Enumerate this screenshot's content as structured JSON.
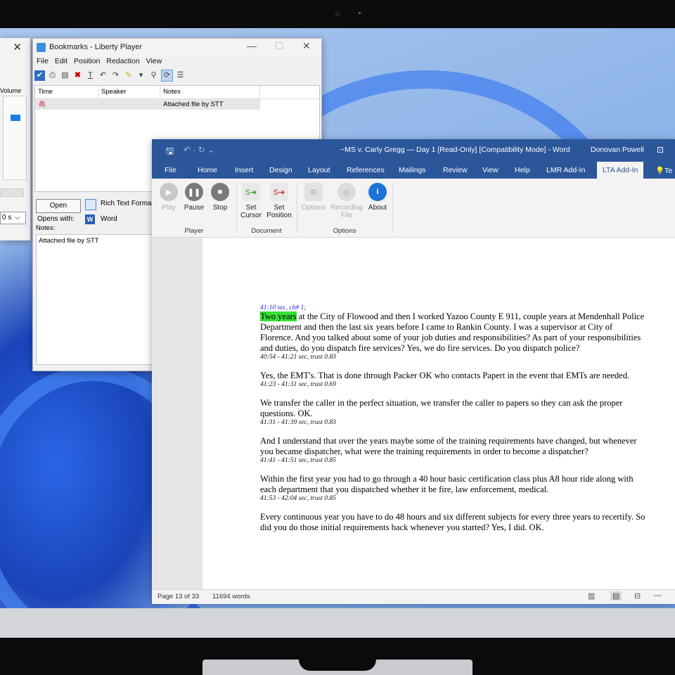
{
  "left_window": {
    "close_glyph": "✕",
    "volume_label": "Volume",
    "combo_value": "0 s",
    "combo_arrow": "⌵"
  },
  "bookmarks": {
    "title": "Bookmarks - Liberty Player",
    "window_controls": {
      "minimize": "—",
      "maximize": "☐",
      "close": "✕"
    },
    "menu": [
      "File",
      "Edit",
      "Position",
      "Redaction",
      "View"
    ],
    "columns": [
      "Time",
      "Speaker",
      "Notes"
    ],
    "rows": [
      {
        "time_icon": "attachment-icon",
        "speaker": "",
        "notes": "Attached file by STT"
      }
    ],
    "open_button": "Open",
    "format_label": "Rich Text Format",
    "opens_with_label": "Opens with:",
    "opens_with_app": "Word",
    "word_icon_letter": "W",
    "notes_label": "Notes:",
    "notes_text": "Attached file by STT"
  },
  "word": {
    "title": "~MS v. Carly Gregg — Day 1 [Read-Only] [Compatibility Mode]  -  Word",
    "user": "Donovan Powell",
    "quick_access": {
      "save": "🖫",
      "undo": "↶ ·  ↻  ⌄"
    },
    "restore_glyph": "⊡",
    "tabs": [
      "File",
      "Home",
      "Insert",
      "Design",
      "Layout",
      "References",
      "Mailings",
      "Review",
      "View",
      "Help",
      "LMR Add-In",
      "LTA Add-In",
      "Te"
    ],
    "active_tab": "LTA Add-In",
    "ribbon": {
      "buttons": [
        {
          "label": "Play",
          "icon": "play-icon",
          "disabled": true
        },
        {
          "label": "Pause",
          "icon": "pause-icon",
          "disabled": false
        },
        {
          "label": "Stop",
          "icon": "stop-icon",
          "disabled": false
        },
        {
          "label": "Set Cursor",
          "icon": "set-cursor-icon",
          "disabled": false
        },
        {
          "label": "Set Position",
          "icon": "set-position-icon",
          "disabled": false
        },
        {
          "label": "Options",
          "icon": "options-icon",
          "disabled": true
        },
        {
          "label": "Recording File",
          "icon": "recording-file-icon",
          "disabled": true
        },
        {
          "label": "About",
          "icon": "info-icon",
          "disabled": false
        }
      ],
      "groups": [
        "Player",
        "Document",
        "Options"
      ]
    },
    "document": [
      {
        "ts_top": "41:10 sec, ch# 1;",
        "highlight": "Two years",
        "text": " at the City of Flowood and then I worked Yazoo County E 911, couple years at Mendenhall Police Department and then the last six years before I came to Rankin County. I was a supervisor at City of Florence. And you talked about some of your job duties and responsibilities? As part of your responsibilities and duties, do you dispatch fire services? Yes, we do fire services. Do you dispatch police?",
        "ts": "40:54 - 41:21 sec, trust 0.83"
      },
      {
        "text": "Yes, the EMT's. That is done through Packer OK who contacts Papert in the event that EMTs are needed.",
        "ts": "41:23 - 41:31 sec, trust 0.69"
      },
      {
        "text": "We transfer the caller in the perfect situation, we transfer the caller to papers so they can ask the proper questions. OK.",
        "ts": "41:31 - 41:39 sec, trust 0.83"
      },
      {
        "text": "And I understand that over the years maybe some of the training requirements have changed, but whenever you became dispatcher, what were the training requirements in order to become a dispatcher?",
        "ts": "41:41 - 41:51 sec, trust 0.85"
      },
      {
        "text": "Within the first year you had to go through a 40 hour basic certification class plus A8 hour ride along with each department that you dispatched whether it be fire, law enforcement, medical.",
        "ts": "41:53 - 42:04 sec, trust 0.85"
      },
      {
        "text": "Every continuous year you have to do 48 hours and six different subjects for every three years to recertify. So did you do those initial requirements back whenever you started? Yes, I did. OK.",
        "ts": ""
      }
    ],
    "status": {
      "page": "Page 13 of 33",
      "words": "11694 words",
      "zoom_sep": "—"
    }
  }
}
